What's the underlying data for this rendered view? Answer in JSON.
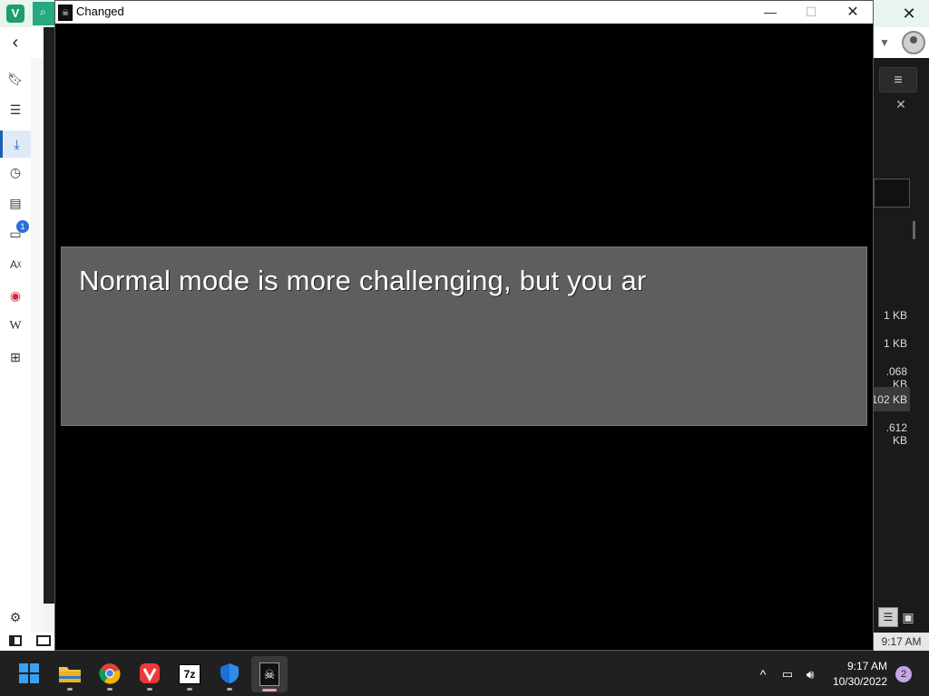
{
  "browser": {
    "logo_letter": "V",
    "close_symbol": "✕",
    "back_symbol": "‹",
    "sidebar_badge": "1",
    "right_panel": {
      "sizes": [
        "1 KB",
        "1 KB",
        ".068 KB",
        "102 KB",
        ".612 KB"
      ],
      "time": "9:17 AM"
    }
  },
  "game_window": {
    "title": "Changed",
    "minimize_symbol": "—",
    "maximize_symbol": "☐",
    "close_symbol": "✕",
    "dialog_text": "Normal mode is more challenging, but you ar"
  },
  "taskbar": {
    "apps": [
      {
        "name": "start",
        "icon": "windows-start-icon"
      },
      {
        "name": "file-explorer",
        "icon": "folder-icon"
      },
      {
        "name": "chrome",
        "icon": "chrome-icon"
      },
      {
        "name": "vivaldi",
        "icon": "vivaldi-icon"
      },
      {
        "name": "7zip",
        "icon": "7zip-icon",
        "label": "7z"
      },
      {
        "name": "defender",
        "icon": "shield-icon"
      },
      {
        "name": "changed-game",
        "icon": "game-icon"
      }
    ],
    "time": "9:17 AM",
    "date": "10/30/2022",
    "notification_count": "2"
  }
}
